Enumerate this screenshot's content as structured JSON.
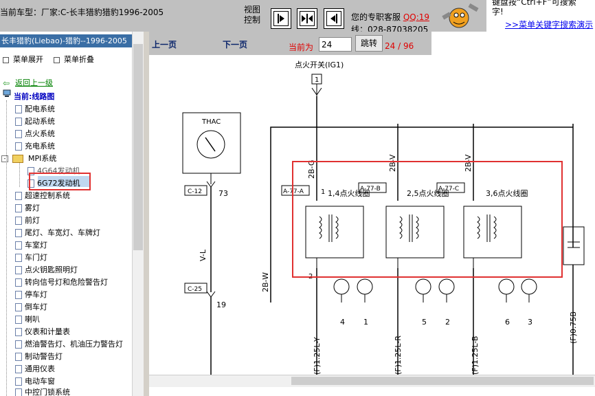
{
  "header": {
    "car_info": "当前车型：厂家:C-长丰猎豹猎豹1996-2005",
    "view_control": "视图控制",
    "service_label": "您的专职客服",
    "qq": "QQ:19",
    "phone": "线：028-87038205",
    "tip_line1": "键盘按“Ctrl+F”可搜索",
    "tip_line2": "字!",
    "tip_link": ">>菜单关键字搜索演示"
  },
  "sidebar": {
    "title": "长丰猎豹(Liebao)-猎豹--1996-2005",
    "expand": "菜单展开",
    "collapse": "菜单折叠",
    "back": "返回上一级",
    "current": "当前:线路图",
    "items": [
      {
        "label": "配电系统"
      },
      {
        "label": "起动系统"
      },
      {
        "label": "点火系统"
      },
      {
        "label": "充电系统"
      },
      {
        "label": "MPI系统"
      },
      {
        "label": "4G64发动机"
      },
      {
        "label": "6G72发动机"
      },
      {
        "label": "超速控制系统"
      },
      {
        "label": "雾灯"
      },
      {
        "label": "前灯"
      },
      {
        "label": "尾灯、车宽灯、车牌灯"
      },
      {
        "label": "车室灯"
      },
      {
        "label": "车门灯"
      },
      {
        "label": "点火钥匙照明灯"
      },
      {
        "label": "转向信号灯和危险警告灯"
      },
      {
        "label": "停车灯"
      },
      {
        "label": "倒车灯"
      },
      {
        "label": "喇叭"
      },
      {
        "label": "仪表和计量表"
      },
      {
        "label": "燃油警告灯、机油压力警告灯"
      },
      {
        "label": "制动警告灯"
      },
      {
        "label": "通用仪表"
      },
      {
        "label": "电动车窗"
      },
      {
        "label": "中控门锁系统"
      }
    ]
  },
  "viewer": {
    "prev": "上一页",
    "next": "下一页",
    "current_label": "当前为",
    "page_value": "24",
    "jump": "跳转",
    "page_count": "24 / 96"
  },
  "diagram": {
    "ig1": "点火开关(IG1)",
    "ig_pin": "1",
    "thac": "THAC",
    "c12": "C-12",
    "n73": "73",
    "vl": "V-L",
    "c25": "C-25",
    "n19": "19",
    "w2b": "2B-W",
    "g2b": "2B-G",
    "v2b_a": "2B-V",
    "v2b_b": "2B-V",
    "a77a": "A-77-A",
    "a77b": "A-77-B",
    "a77c": "A-77-C",
    "coil14": "1,4点火线圈",
    "coil25": "2,5点火线圈",
    "coil36": "3,6点火线圈",
    "n1": "1",
    "n2": "2",
    "cyl": [
      "4",
      "1",
      "5",
      "2",
      "6",
      "3"
    ],
    "f125l_y": "(F)1.25L-Y",
    "f125l_r": "(F)1.25L-R",
    "f125l_b": "(F)1.25L-B",
    "f075b": "(F)0.75B"
  },
  "colors": {
    "accent_red": "#e00000",
    "sidebar_header": "#3a6ea5",
    "highlight_box": "#e03030"
  }
}
